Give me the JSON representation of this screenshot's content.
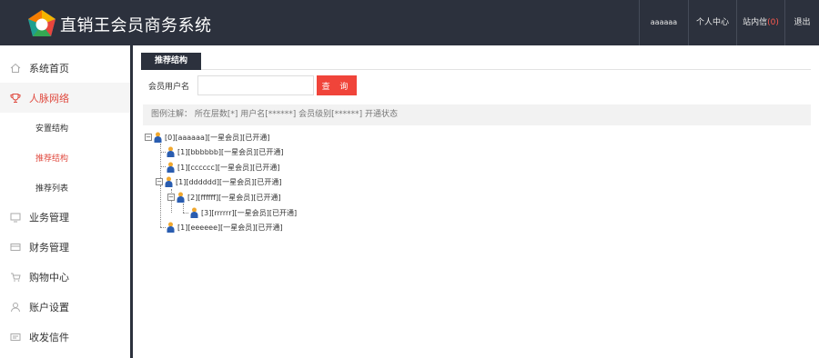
{
  "app": {
    "title": "直销王会员商务系统"
  },
  "topnav": {
    "user": "aaaaaa",
    "center": "个人中心",
    "messages_label": "站内信",
    "messages_count": "(0)",
    "logout": "退出"
  },
  "sidebar": {
    "items": [
      {
        "label": "系统首页",
        "icon": "home-icon"
      },
      {
        "label": "人脉网络",
        "icon": "trophy-icon"
      },
      {
        "label": "业务管理",
        "icon": "monitor-icon"
      },
      {
        "label": "财务管理",
        "icon": "card-icon"
      },
      {
        "label": "购物中心",
        "icon": "cart-icon"
      },
      {
        "label": "账户设置",
        "icon": "user-icon"
      },
      {
        "label": "收发信件",
        "icon": "mail-icon"
      }
    ],
    "subitems": [
      {
        "label": "安置结构"
      },
      {
        "label": "推荐结构"
      },
      {
        "label": "推荐列表"
      }
    ]
  },
  "main": {
    "tab": "推荐结构",
    "search": {
      "label": "会员用户名",
      "value": "",
      "button": "查 询"
    },
    "legend": "图例注解： 所在层数[*] 用户名[******] 会员级别[******] 开通状态",
    "tree": [
      {
        "text": "[0][aaaaaa][一星会员][已开通]"
      },
      {
        "text": "[1][bbbbbb][一星会员][已开通]"
      },
      {
        "text": "[1][cccccc][一星会员][已开通]"
      },
      {
        "text": "[1][dddddd][一星会员][已开通]"
      },
      {
        "text": "[2][ffffff][一星会员][已开通]"
      },
      {
        "text": "[3][rrrrrr][一星会员][已开通]"
      },
      {
        "text": "[1][eeeeee][一星会员][已开通]"
      }
    ]
  },
  "colors": {
    "topbar": "#2c313d",
    "accent": "#e04a3f",
    "button": "#f0443a"
  }
}
